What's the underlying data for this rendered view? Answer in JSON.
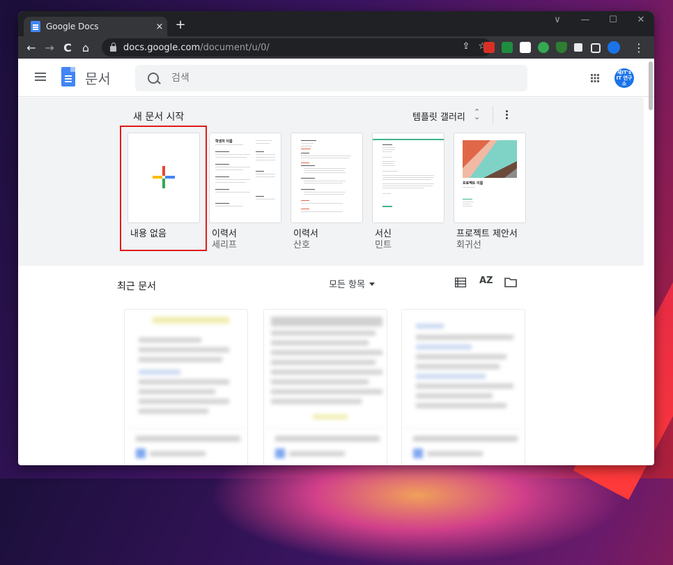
{
  "browser": {
    "tab_title": "Google Docs",
    "tab_close": "×",
    "new_tab": "+",
    "url_host": "docs.google.com",
    "url_path": "/document/u/0/",
    "window_controls": [
      "∨",
      "—",
      "☐",
      "✕"
    ],
    "nav": {
      "back": "←",
      "forward": "→",
      "reload": "C",
      "home": "⌂"
    }
  },
  "docs": {
    "app_title": "문서",
    "search_placeholder": "검색",
    "avatar_text": "새IT's IT 연구소"
  },
  "gallery": {
    "heading": "새 문서 시작",
    "gallery_link": "템플릿 갤러리",
    "templates": [
      {
        "title": "내용 없음",
        "subtitle": ""
      },
      {
        "title": "이력서",
        "subtitle": "세리프"
      },
      {
        "title": "이력서",
        "subtitle": "산호"
      },
      {
        "title": "서신",
        "subtitle": "민트"
      },
      {
        "title": "프로젝트 제안서",
        "subtitle": "회귀선"
      }
    ],
    "template_preview_texts": {
      "serif_name": "학생자 이름",
      "project_title": "프로젝트 이름"
    }
  },
  "recent": {
    "heading": "최근 문서",
    "filter": "모든 항목",
    "sort_icon_label": "AZ"
  },
  "colors": {
    "docs_blue": "#4285f4",
    "highlight_red": "#e21a1a",
    "gallery_bg": "#f1f3f4"
  }
}
